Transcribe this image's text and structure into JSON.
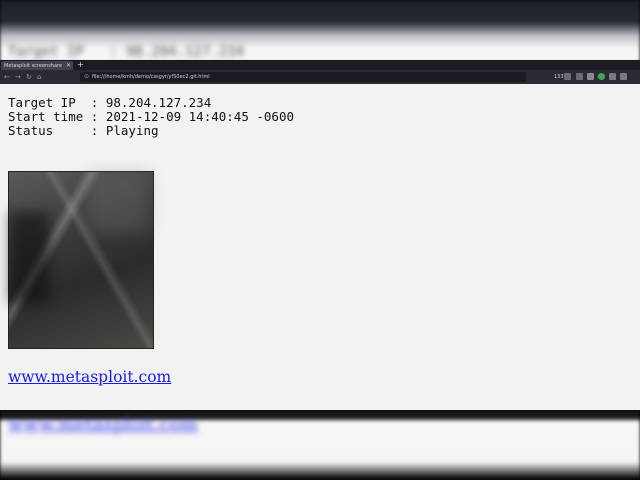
{
  "backdrop": {
    "top_text": "Target IP   : 98.204.127.234",
    "bottom_link": "www.metasploit.com"
  },
  "browser": {
    "tab": {
      "title": "Metasploit screenshare",
      "close_icon": "close-icon"
    },
    "new_tab_icon": "plus-icon",
    "url": "file:///home/kmh/demo/cssgyr/yfS0ec2.git.html",
    "zoom": "133%",
    "colors": {
      "tabbar": "#1c1b22",
      "navbar": "#2b2a33",
      "urlbar": "#1c1b22",
      "page_bg": "#f2f2f2"
    }
  },
  "page": {
    "rows": [
      {
        "label": "Target IP  ",
        "value": "98.204.127.234"
      },
      {
        "label": "Start time ",
        "value": "2021-12-09 14:40:45 -0600"
      },
      {
        "label": "Status     ",
        "value": "Playing"
      }
    ],
    "link": "www.metasploit.com",
    "link_color": "#1a1aee"
  }
}
